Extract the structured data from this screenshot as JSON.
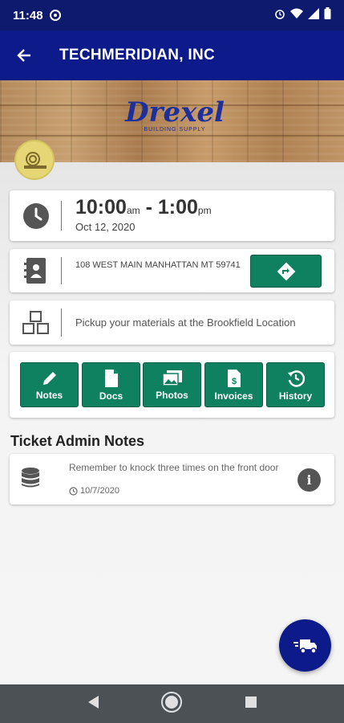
{
  "status_bar": {
    "time": "11:48"
  },
  "app_bar": {
    "title": "TECHMERIDIAN, INC"
  },
  "banner": {
    "logo_text": "Drexel",
    "logo_subtext": "BUILDING SUPPLY"
  },
  "schedule": {
    "start": "10:00",
    "start_suffix": "am",
    "separator": " - ",
    "end": "1:00",
    "end_suffix": "pm",
    "date": "Oct 12, 2020"
  },
  "address": {
    "line": "108 WEST MAIN MANHATTAN MT 59741"
  },
  "pickup": {
    "text": "Pickup your materials at the Brookfield Location"
  },
  "actions": [
    {
      "label": "Notes",
      "icon": "pencil-icon"
    },
    {
      "label": "Docs",
      "icon": "document-icon"
    },
    {
      "label": "Photos",
      "icon": "photos-icon"
    },
    {
      "label": "Invoices",
      "icon": "invoice-icon"
    },
    {
      "label": "History",
      "icon": "history-icon"
    }
  ],
  "admin_notes": {
    "heading": "Ticket Admin Notes",
    "items": [
      {
        "text": "Remember to knock three times on the front door",
        "date": "10/7/2020"
      }
    ]
  },
  "colors": {
    "primary": "#0d1a8a",
    "status_bar": "#0d1a6e",
    "action_green": "#0f8060",
    "nav_bar": "#4c5155"
  }
}
